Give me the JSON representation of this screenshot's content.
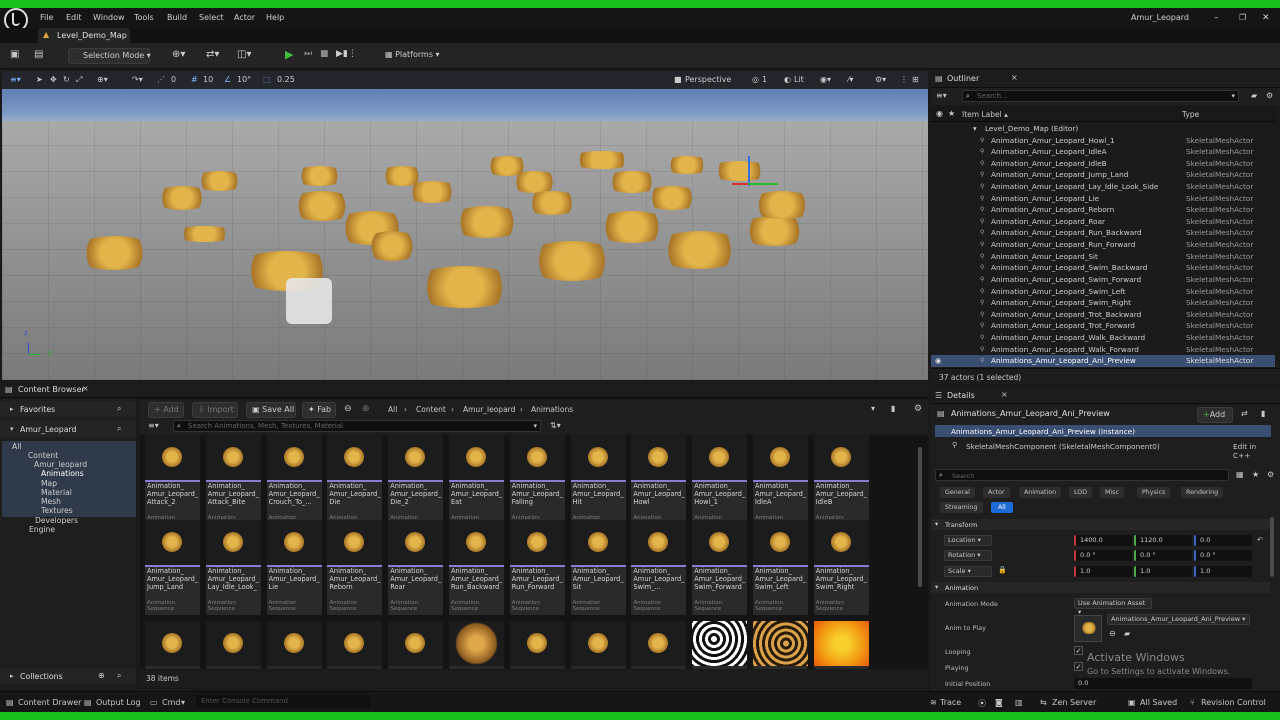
{
  "window": {
    "title": "Amur_Leopard"
  },
  "menu": [
    "File",
    "Edit",
    "Window",
    "Tools",
    "Build",
    "Select",
    "Actor",
    "Help"
  ],
  "level_tab": "Level_Demo_Map",
  "toolbar": {
    "mode": "Selection Mode",
    "platforms": "Platforms"
  },
  "viewport": {
    "snap_angle": "0",
    "grid": "10",
    "rot_snap": "10°",
    "scale_snap": "0.25",
    "view": "Perspective",
    "lit": "Lit",
    "fov": "1"
  },
  "outliner": {
    "title": "Outliner",
    "search_placeholder": "Search...",
    "col_label": "Item Label ▴",
    "col_type": "Type",
    "root": "Level_Demo_Map (Editor)",
    "rows": [
      {
        "label": "Animation_Amur_Leopard_Howl_1",
        "type": "SkeletalMeshActor"
      },
      {
        "label": "Animation_Amur_Leopard_IdleA",
        "type": "SkeletalMeshActor"
      },
      {
        "label": "Animation_Amur_Leopard_IdleB",
        "type": "SkeletalMeshActor"
      },
      {
        "label": "Animation_Amur_Leopard_Jump_Land",
        "type": "SkeletalMeshActor"
      },
      {
        "label": "Animation_Amur_Leopard_Lay_Idle_Look_Side",
        "type": "SkeletalMeshActor"
      },
      {
        "label": "Animation_Amur_Leopard_Lie",
        "type": "SkeletalMeshActor"
      },
      {
        "label": "Animation_Amur_Leopard_Reborn",
        "type": "SkeletalMeshActor"
      },
      {
        "label": "Animation_Amur_Leopard_Roar",
        "type": "SkeletalMeshActor"
      },
      {
        "label": "Animation_Amur_Leopard_Run_Backward",
        "type": "SkeletalMeshActor"
      },
      {
        "label": "Animation_Amur_Leopard_Run_Forward",
        "type": "SkeletalMeshActor"
      },
      {
        "label": "Animation_Amur_Leopard_Sit",
        "type": "SkeletalMeshActor"
      },
      {
        "label": "Animation_Amur_Leopard_Swim_Backward",
        "type": "SkeletalMeshActor"
      },
      {
        "label": "Animation_Amur_Leopard_Swim_Forward",
        "type": "SkeletalMeshActor"
      },
      {
        "label": "Animation_Amur_Leopard_Swim_Left",
        "type": "SkeletalMeshActor"
      },
      {
        "label": "Animation_Amur_Leopard_Swim_Right",
        "type": "SkeletalMeshActor"
      },
      {
        "label": "Animation_Amur_Leopard_Trot_Backward",
        "type": "SkeletalMeshActor"
      },
      {
        "label": "Animation_Amur_Leopard_Trot_Forward",
        "type": "SkeletalMeshActor"
      },
      {
        "label": "Animation_Amur_Leopard_Walk_Backward",
        "type": "SkeletalMeshActor"
      },
      {
        "label": "Animation_Amur_Leopard_Walk_Forward",
        "type": "SkeletalMeshActor"
      },
      {
        "label": "Animations_Amur_Leopard_Ani_Preview",
        "type": "SkeletalMeshActor"
      }
    ],
    "status": "37 actors (1 selected)"
  },
  "content_browser": {
    "title": "Content Browser",
    "favorites": "Favorites",
    "project": "Amur_Leopard",
    "tree": [
      "All",
      "Content",
      "Amur_leopard",
      "Animations",
      "Map",
      "Material",
      "Mesh",
      "Textures",
      "Developers",
      "Engine"
    ],
    "collections": "Collections",
    "add": "Add",
    "import": "Import",
    "save_all": "Save All",
    "fab": "Fab",
    "path": [
      "All",
      "Content",
      "Amur_leopard",
      "Animations"
    ],
    "search_placeholder": "Search Animations, Mesh, Textures, Material",
    "item_count": "38 items",
    "asset_type": "Animation Sequence",
    "assets_row1": [
      "Animation_\nAmur_Leopard_\nAttack_2",
      "Animation_\nAmur_Leopard_\nAttack_Bite",
      "Animation_\nAmur_Leopard_\nCrouch_To_...",
      "Animation_\nAmur_Leopard_\nDie",
      "Animation_\nAmur_Leopard_\nDie_2",
      "Animation_\nAmur_Leopard_\nEat",
      "Animation_\nAmur_Leopard_\nFalling",
      "Animation_\nAmur_Leopard_\nHit",
      "Animation_\nAmur_Leopard_\nHowl",
      "Animation_\nAmur_Leopard_\nHowl_1",
      "Animation_\nAmur_Leopard_\nIdleA",
      "Animation_\nAmur_Leopard_\nIdleB"
    ],
    "assets_row2": [
      "Animation_\nAmur_Leopard_\nJump_Land",
      "Animation_\nAmur_Leopard_\nLay_Idle_Look_",
      "Animation_\nAmur_Leopard_\nLie",
      "Animation_\nAmur_Leopard_\nReborn",
      "Animation_\nAmur_Leopard_\nRoar",
      "Animation_\nAmur_Leopard_\nRun_Backward",
      "Animation_\nAmur_Leopard_\nRun_Forward",
      "Animation_\nAmur_Leopard_\nSit",
      "Animation_\nAmur_Leopard_\nSwim_...",
      "Animation_\nAmur_Leopard_\nSwim_Forward",
      "Animation_\nAmur_Leopard_\nSwim_Left",
      "Animation_\nAmur_Leopard_\nSwim_Right"
    ]
  },
  "details": {
    "title": "Details",
    "actor_name": "Animations_Amur_Leopard_Ani_Preview",
    "add": "Add",
    "instance": "Animations_Amur_Leopard_Ani_Preview (Instance)",
    "component": "SkeletalMeshComponent (SkeletalMeshComponent0)",
    "edit_cpp": "Edit in C++",
    "search_placeholder": "Search",
    "categories": [
      "General",
      "Actor",
      "Animation",
      "LOD",
      "Misc",
      "Physics",
      "Rendering",
      "Streaming",
      "All"
    ],
    "transform_title": "Transform",
    "location": {
      "label": "Location",
      "x": "1400.0",
      "y": "1120.0",
      "z": "0.0"
    },
    "rotation": {
      "label": "Rotation",
      "x": "0.0 °",
      "y": "0.0 °",
      "z": "0.0 °"
    },
    "scale": {
      "label": "Scale",
      "x": "1.0",
      "y": "1.0",
      "z": "1.0"
    },
    "animation_title": "Animation",
    "anim_mode_label": "Animation Mode",
    "anim_mode_value": "Use Animation Asset",
    "anim_to_play_label": "Anim to Play",
    "anim_to_play_value": "Animations_Amur_Leopard_Ani_Preview",
    "looping": "Looping",
    "playing": "Playing",
    "initial_position": "Initial Position",
    "initial_position_value": "0.0"
  },
  "watermark": {
    "line1": "Activate Windows",
    "line2": "Go to Settings to activate Windows."
  },
  "bottom": {
    "content_drawer": "Content Drawer",
    "output_log": "Output Log",
    "cmd": "Cmd",
    "console_placeholder": "Enter Console Command",
    "trace": "Trace",
    "zen_server": "Zen Server",
    "all_saved": "All Saved",
    "revision_control": "Revision Control"
  }
}
